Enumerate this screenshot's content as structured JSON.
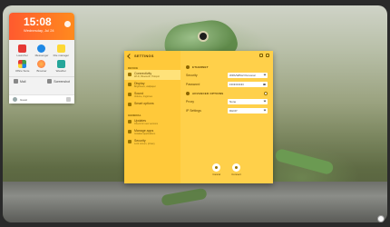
{
  "clock": {
    "time": "15:08",
    "date": "Wednesday, Jul 24"
  },
  "apps": [
    {
      "label": "Launcher",
      "color": "#e53935"
    },
    {
      "label": "Messenger",
      "color": "#1e88e5"
    },
    {
      "label": "File manager",
      "color": "#fdd835"
    },
    {
      "label": "Office Suite",
      "color": "#43a047"
    },
    {
      "label": "Browser",
      "color": "#ff7043"
    },
    {
      "label": "Weather",
      "color": "#26a69a"
    }
  ],
  "quick": {
    "left": "Mail",
    "right": "Screenshot"
  },
  "user": {
    "name": "Guest"
  },
  "settings": {
    "title": "SETTINGS",
    "sections": {
      "device": "DEVICE",
      "general": "GENERAL"
    },
    "side_items": [
      {
        "label": "Connectivity",
        "sub": "Wi-Fi, Bluetooth, Hotspot",
        "active": true
      },
      {
        "label": "Display",
        "sub": "Brightness, wallpaper"
      },
      {
        "label": "Sound",
        "sub": "Volume, ringtones"
      },
      {
        "label": "Smart options",
        "sub": ""
      },
      {
        "label": "Updates",
        "sub": "Check for new versions"
      },
      {
        "label": "Manage apps",
        "sub": "Installed applications"
      },
      {
        "label": "Security",
        "sub": "Lock screen, privacy"
      }
    ],
    "main": {
      "sec1": "ETHERNET",
      "security_label": "Security",
      "security_value": "WPA/WPA2 Personal",
      "password_label": "Password",
      "password_value": "••••••••••",
      "sec2": "ADVANCED OPTIONS",
      "proxy_label": "Proxy",
      "proxy_value": "None",
      "ip_label": "IP Settings",
      "ip_value": "DHCP"
    },
    "footer": {
      "cancel": "Cancel",
      "connect": "Connect"
    }
  }
}
